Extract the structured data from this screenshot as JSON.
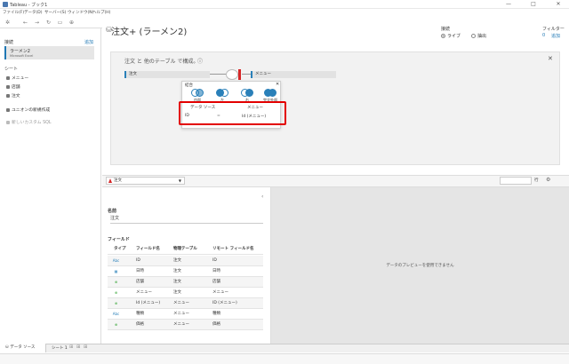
{
  "window": {
    "title": "Tableau - ブック1",
    "controls": [
      "—",
      "□",
      "✕"
    ]
  },
  "menu": [
    "ファイル(F)",
    "データ(D)",
    "サーバー(S)",
    "ウィンドウ(N)",
    "ヘルプ(H)"
  ],
  "connections": {
    "header": "接続",
    "add_label": "追加",
    "item_name": "ラーメン2",
    "item_type": "Microsoft Excel"
  },
  "sheets": {
    "header": "シート",
    "items": [
      "メニュー",
      "店舗",
      "注文"
    ],
    "union_label": "ユニオンの新規作成",
    "custom_sql_label": "新しいカスタム SQL"
  },
  "datasource": {
    "title": "注文+ (ラーメン2)",
    "connection_label": "接続",
    "live_label": "ライブ",
    "extract_label": "抽出",
    "filter_label": "フィルター",
    "filter_count": "0",
    "filter_add": "追加",
    "join_hint": "注文 と 他のテーブル で構成。",
    "left_table": "注文",
    "right_table": "メニュー"
  },
  "join_popup": {
    "title": "結合",
    "types": [
      "内部",
      "左",
      "右",
      "完全外部"
    ],
    "source_header": "データ ソース",
    "right_header": "メニュー",
    "left_field": "ID",
    "operator": "=",
    "right_field": "Id (メニュー)"
  },
  "grid_toolbar": {
    "table_name": "注文",
    "rows_label": "行"
  },
  "meta": {
    "name_label": "名前",
    "name_value": "注文",
    "fields_label": "フィールド",
    "headers": [
      "タイプ",
      "フィールド名",
      "物理テーブル",
      "リモート フィールド名"
    ],
    "rows": [
      {
        "type": "Abc",
        "field": "ID",
        "table": "注文",
        "remote": "ID"
      },
      {
        "type": "cal",
        "field": "日時",
        "table": "注文",
        "remote": "日時"
      },
      {
        "type": "geo",
        "field": "店舗",
        "table": "注文",
        "remote": "店舗"
      },
      {
        "type": "geo",
        "field": "メニュー",
        "table": "注文",
        "remote": "メニュー"
      },
      {
        "type": "geo",
        "field": "Id (メニュー)",
        "table": "メニュー",
        "remote": "ID (メニュー)"
      },
      {
        "type": "Abc",
        "field": "種類",
        "table": "メニュー",
        "remote": "種類"
      },
      {
        "type": "geo",
        "field": "価格",
        "table": "メニュー",
        "remote": "価格"
      }
    ]
  },
  "preview": {
    "message": "データのプレビューを使用できません"
  },
  "bottom_tabs": {
    "datasource": "データ ソース",
    "sheet": "シート 1"
  }
}
